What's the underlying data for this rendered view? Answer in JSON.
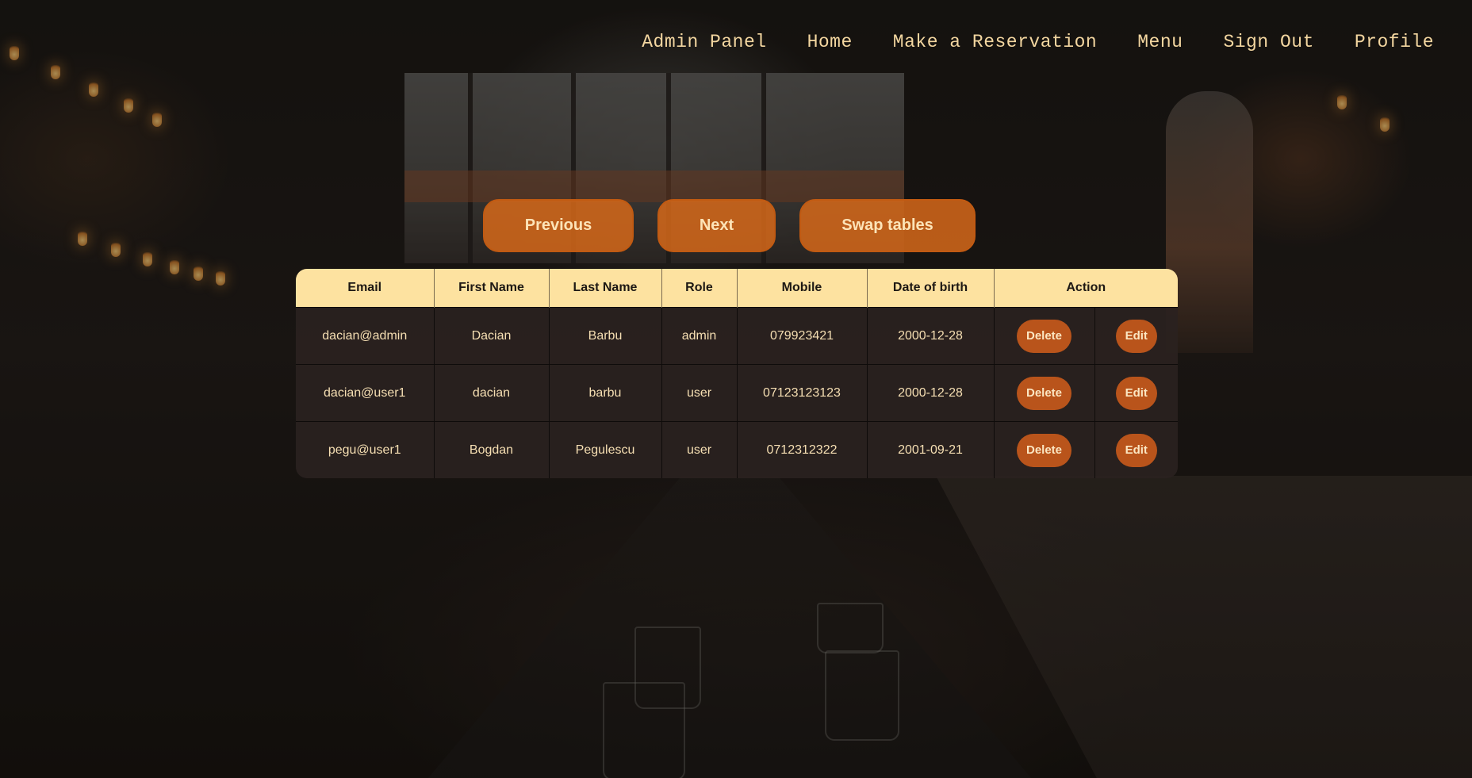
{
  "nav": {
    "items": [
      {
        "label": "Admin Panel"
      },
      {
        "label": "Home"
      },
      {
        "label": "Make a Reservation"
      },
      {
        "label": "Menu"
      },
      {
        "label": "Sign Out"
      },
      {
        "label": "Profile"
      }
    ]
  },
  "pager": {
    "previous_label": "Previous",
    "next_label": "Next",
    "swap_label": "Swap tables"
  },
  "table": {
    "headers": [
      "Email",
      "First Name",
      "Last Name",
      "Role",
      "Mobile",
      "Date of birth",
      "Action"
    ],
    "rows": [
      {
        "email": "dacian@admin",
        "first_name": "Dacian",
        "last_name": "Barbu",
        "role": "admin",
        "mobile": "079923421",
        "dob": "2000-12-28",
        "delete_label": "Delete",
        "edit_label": "Edit"
      },
      {
        "email": "dacian@user1",
        "first_name": "dacian",
        "last_name": "barbu",
        "role": "user",
        "mobile": "07123123123",
        "dob": "2000-12-28",
        "delete_label": "Delete",
        "edit_label": "Edit"
      },
      {
        "email": "pegu@user1",
        "first_name": "Bogdan",
        "last_name": "Pegulescu",
        "role": "user",
        "mobile": "0712312322",
        "dob": "2001-09-21",
        "delete_label": "Delete",
        "edit_label": "Edit"
      }
    ]
  },
  "colors": {
    "accent": "#d6681a",
    "header_bg": "#fde2a0",
    "row_bg": "#2a221f",
    "text_light": "#f6dfb3",
    "button": "#b9541b"
  }
}
